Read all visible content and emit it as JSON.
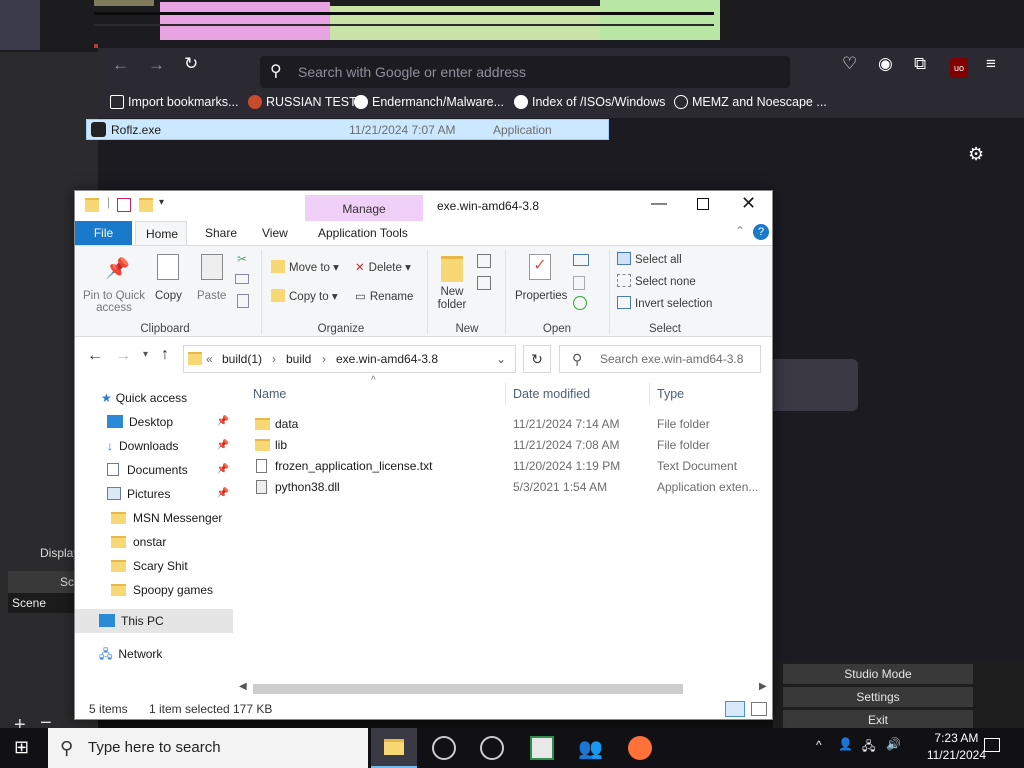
{
  "browser": {
    "url_placeholder": "Search with Google or enter address",
    "bookmarks": [
      "Import bookmarks...",
      "RUSSIAN TEST",
      "Endermanch/Malware...",
      "Index of /ISOs/Windows",
      "MEMZ and Noescape ..."
    ]
  },
  "obs": {
    "display_label": "Display",
    "scenes_label": "Sc",
    "scene_label": "Scene",
    "studio_mode": "Studio Mode",
    "settings": "Settings",
    "exit": "Exit"
  },
  "explorer": {
    "title": "exe.win-amd64-3.8",
    "manage_label": "Manage",
    "tabs": [
      "File",
      "Home",
      "Share",
      "View",
      "Application Tools"
    ],
    "ribbon": {
      "pin": "Pin to Quick access",
      "copy": "Copy",
      "paste": "Paste",
      "clipboard": "Clipboard",
      "move_to": "Move to",
      "copy_to": "Copy to",
      "delete": "Delete",
      "rename": "Rename",
      "organize": "Organize",
      "new_folder": "New folder",
      "new": "New",
      "properties": "Properties",
      "open": "Open",
      "select_all": "Select all",
      "select_none": "Select none",
      "invert_selection": "Invert selection",
      "select": "Select"
    },
    "breadcrumb": [
      "build(1)",
      "build",
      "exe.win-amd64-3.8"
    ],
    "search_placeholder": "Search exe.win-amd64-3.8",
    "nav": {
      "quick_access": "Quick access",
      "items": [
        "Desktop",
        "Downloads",
        "Documents",
        "Pictures",
        "MSN Messenger",
        "onstar",
        "Scary Shit",
        "Spoopy games"
      ],
      "this_pc": "This PC",
      "network": "Network"
    },
    "columns": [
      "Name",
      "Date modified",
      "Type"
    ],
    "files": [
      {
        "name": "data",
        "date": "11/21/2024 7:14 AM",
        "type": "File folder"
      },
      {
        "name": "lib",
        "date": "11/21/2024 7:08 AM",
        "type": "File folder"
      },
      {
        "name": "frozen_application_license.txt",
        "date": "11/20/2024 1:19 PM",
        "type": "Text Document"
      },
      {
        "name": "python38.dll",
        "date": "5/3/2021 1:54 AM",
        "type": "Application exten..."
      },
      {
        "name": "Roflz.exe",
        "date": "11/21/2024 7:07 AM",
        "type": "Application"
      }
    ],
    "status": {
      "items": "5 items",
      "selected": "1 item selected",
      "size": "177 KB"
    }
  },
  "taskbar": {
    "search_placeholder": "Type here to search",
    "time": "7:23 AM",
    "date": "11/21/2024"
  },
  "colors": {
    "accent": "#1979ca",
    "selection": "#cce8ff",
    "manage": "#f1d0f7"
  }
}
